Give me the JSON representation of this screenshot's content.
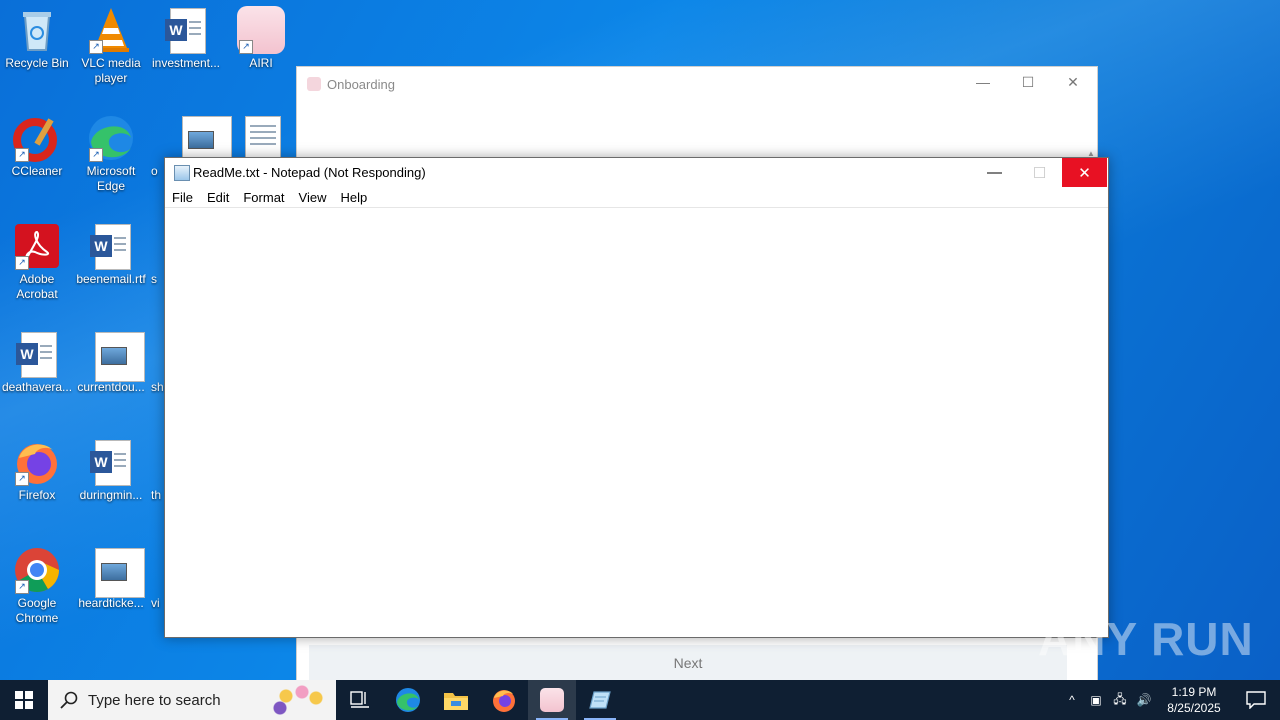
{
  "desktop": {
    "icons": [
      {
        "label": "Recycle Bin"
      },
      {
        "label": "VLC media player"
      },
      {
        "label": "investment..."
      },
      {
        "label": "AIRI"
      },
      {
        "label": "CCleaner"
      },
      {
        "label": "Microsoft Edge"
      },
      {
        "label": "o"
      },
      {
        "label": "Adobe Acrobat"
      },
      {
        "label": "beenemail.rtf"
      },
      {
        "label": "s"
      },
      {
        "label": "deathavera..."
      },
      {
        "label": "currentdou..."
      },
      {
        "label": "sh"
      },
      {
        "label": "Firefox"
      },
      {
        "label": "duringmin..."
      },
      {
        "label": "th"
      },
      {
        "label": "Google Chrome"
      },
      {
        "label": "heardticke..."
      },
      {
        "label": "vi"
      }
    ]
  },
  "onboarding": {
    "title": "Onboarding",
    "next_label": "Next",
    "minimize_glyph": "—",
    "maximize_glyph": "☐",
    "close_glyph": "✕"
  },
  "notepad": {
    "title": "ReadMe.txt - Notepad (Not Responding)",
    "menu": [
      "File",
      "Edit",
      "Format",
      "View",
      "Help"
    ],
    "minimize_glyph": "—",
    "maximize_glyph": "☐",
    "close_glyph": "✕"
  },
  "watermark": "ANY RUN",
  "taskbar": {
    "search_placeholder": "Type here to search",
    "time": "1:19 PM",
    "date": "8/25/2025",
    "tray_chevron": "^"
  },
  "colors": {
    "close_red": "#e81123",
    "taskbar_bg": "#0f1f33",
    "desktop_blue": "#0c86e8"
  }
}
